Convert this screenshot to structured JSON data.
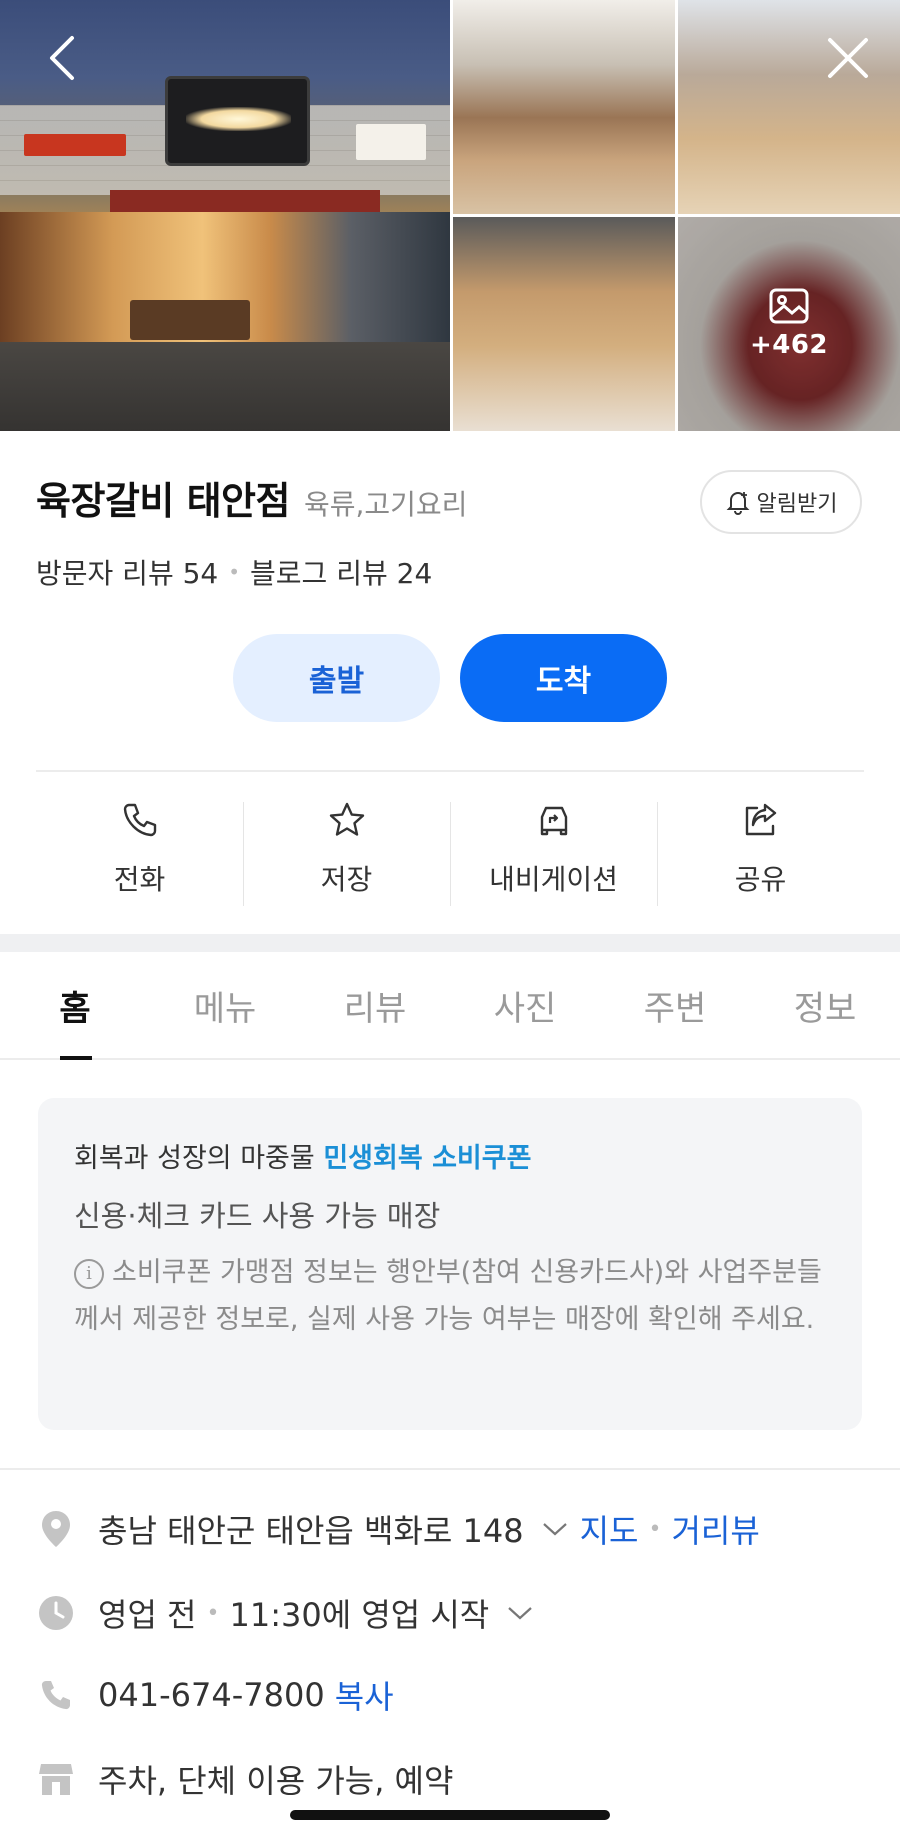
{
  "photos": {
    "more_count": "+462"
  },
  "place": {
    "name": "육장갈비 태안점",
    "category": "육류,고기요리",
    "alert_label": "알림받기",
    "visitor_reviews": "방문자 리뷰 54",
    "blog_reviews": "블로그 리뷰 24",
    "dot": "•"
  },
  "route": {
    "start_label": "출발",
    "end_label": "도착"
  },
  "actions": [
    {
      "label": "전화",
      "icon": "phone-icon"
    },
    {
      "label": "저장",
      "icon": "star-icon"
    },
    {
      "label": "내비게이션",
      "icon": "car-navigation-icon"
    },
    {
      "label": "공유",
      "icon": "share-icon"
    }
  ],
  "tabs": [
    "홈",
    "메뉴",
    "리뷰",
    "사진",
    "주변",
    "정보"
  ],
  "active_tab": "홈",
  "coupon": {
    "line1_prefix": "회복과 성장의 마중물",
    "line1_highlight": "민생회복 소비쿠폰",
    "line2": "신용·체크 카드 사용 가능 매장",
    "info_symbol": "i",
    "notice": "소비쿠폰 가맹점 정보는 행안부(참여 신용카드사)와 사업주분들께서 제공한 정보로, 실제 사용 가능 여부는 매장에 확인해 주세요."
  },
  "info": {
    "address": "충남 태안군 태안읍 백화로 148",
    "map_link": "지도",
    "street_view_link": "거리뷰",
    "hours_status": "영업 전",
    "hours_detail": "11:30에 영업 시작",
    "phone": "041-674-7800",
    "copy_label": "복사",
    "amenities": "주차, 단체 이용 가능, 예약"
  },
  "colors": {
    "accent_blue": "#0a6cf5",
    "link_blue": "#1a62d6",
    "coupon_highlight": "#1b8fd6",
    "start_button_bg": "#e4efff"
  }
}
